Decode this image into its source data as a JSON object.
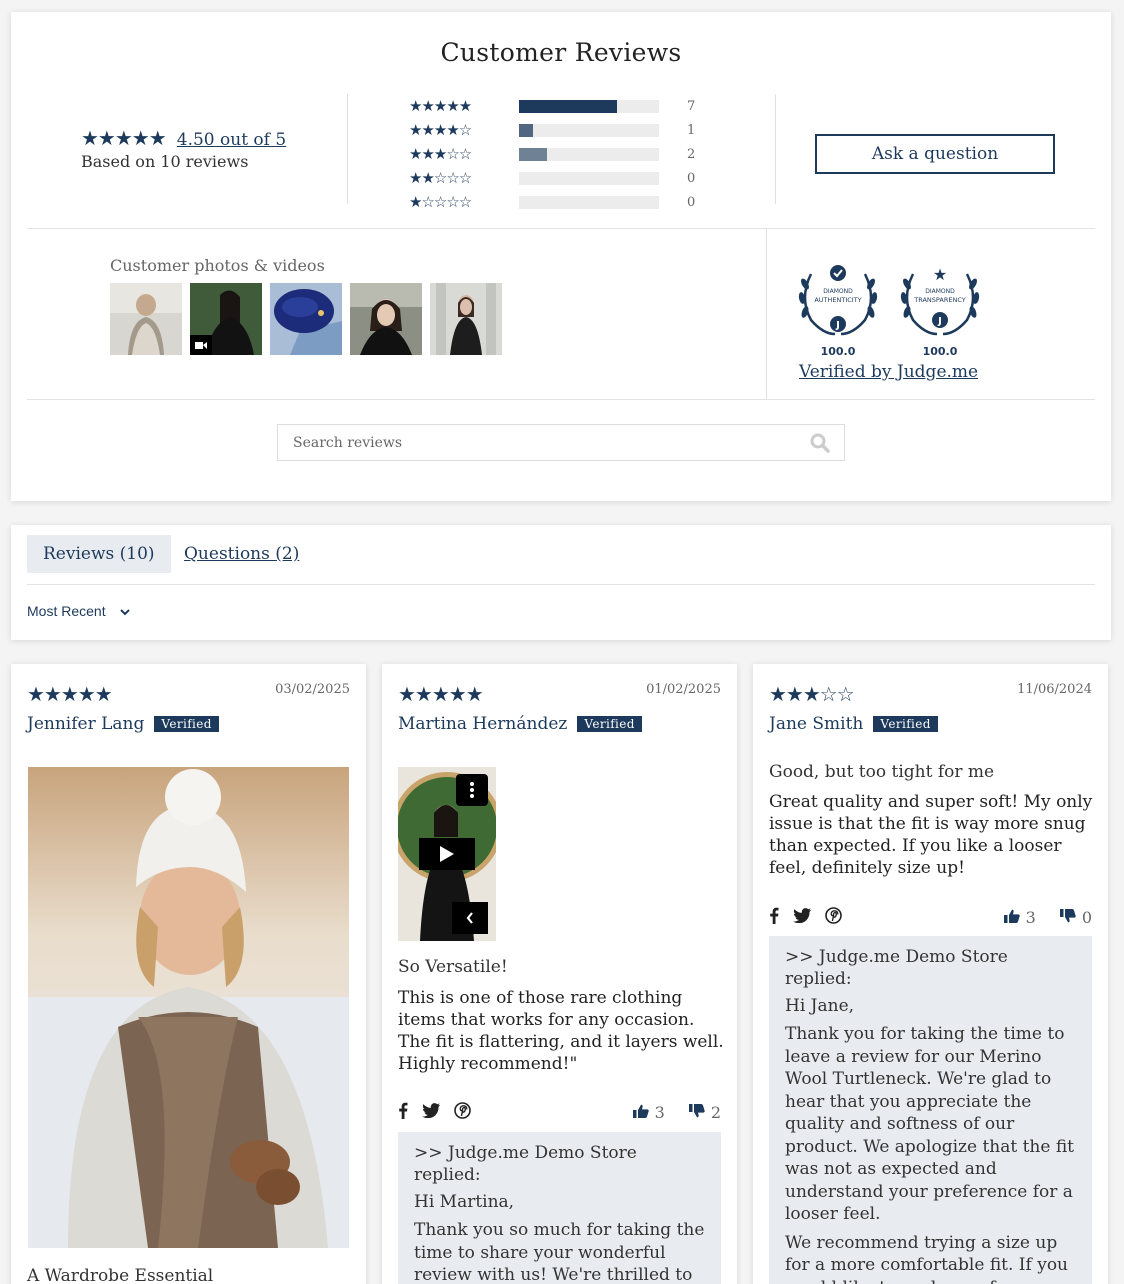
{
  "summary": {
    "title": "Customer Reviews",
    "average_stars": "★★★★★",
    "average_label": "4.50 out of 5",
    "average_value": 4.5,
    "based_on": "Based on 10 reviews",
    "histogram": [
      {
        "stars": "★★★★★",
        "count": "7",
        "fraction": 0.7
      },
      {
        "stars": "★★★★☆",
        "count": "1",
        "fraction": 0.1
      },
      {
        "stars": "★★★☆☆",
        "count": "2",
        "fraction": 0.2
      },
      {
        "stars": "★★☆☆☆",
        "count": "0",
        "fraction": 0
      },
      {
        "stars": "★☆☆☆☆",
        "count": "0",
        "fraction": 0
      }
    ],
    "ask_button": "Ask a question",
    "photos_label": "Customer photos & videos",
    "badges": [
      {
        "label": "DIAMOND AUTHENTICITY",
        "value": "100.0"
      },
      {
        "label": "DIAMOND TRANSPARENCY",
        "value": "100.0"
      }
    ],
    "verified_by": "Verified by Judge.me",
    "search_placeholder": "Search reviews"
  },
  "tabs": {
    "reviews": "Reviews (10)",
    "questions": "Questions (2)",
    "sort": "Most Recent"
  },
  "reviews": [
    {
      "stars": "★★★★★",
      "date": "03/02/2025",
      "name": "Jennifer Lang",
      "verified": "Verified",
      "title": "A Wardrobe Essential"
    },
    {
      "stars": "★★★★★",
      "date": "01/02/2025",
      "name": "Martina Hernández",
      "verified": "Verified",
      "title": "So Versatile!",
      "body": "This is one of those rare clothing items that works for any occasion. The fit is flattering, and it layers well. Highly recommend!\"",
      "up": "3",
      "down": "2",
      "reply_header": ">> Judge.me Demo Store replied:",
      "reply_greeting": "Hi Martina,",
      "reply_p1": "Thank you so much for taking the time to share your wonderful review with us! We're thrilled to hear that our Merino Wool"
    },
    {
      "stars": "★★★☆☆",
      "date": "11/06/2024",
      "name": "Jane Smith",
      "verified": "Verified",
      "title": "Good, but too tight for me",
      "body": "Great quality and super soft! My only issue is that the fit is way more snug than expected. If you like a looser feel, definitely size up!",
      "up": "3",
      "down": "0",
      "reply_header": ">> Judge.me Demo Store replied:",
      "reply_greeting": "Hi Jane,",
      "reply_p1": "Thank you for taking the time to leave a review for our Merino Wool Turtleneck. We're glad to hear that you appreciate the quality and softness of our product. We apologize that the fit was not as expected and understand your preference for a looser feel.",
      "reply_p2": "We recommend trying a size up for a more comfortable fit. If you would like to exchange for a"
    }
  ],
  "colors": {
    "accent": "#1d3a5c",
    "tab_bg": "#e8ebef"
  }
}
